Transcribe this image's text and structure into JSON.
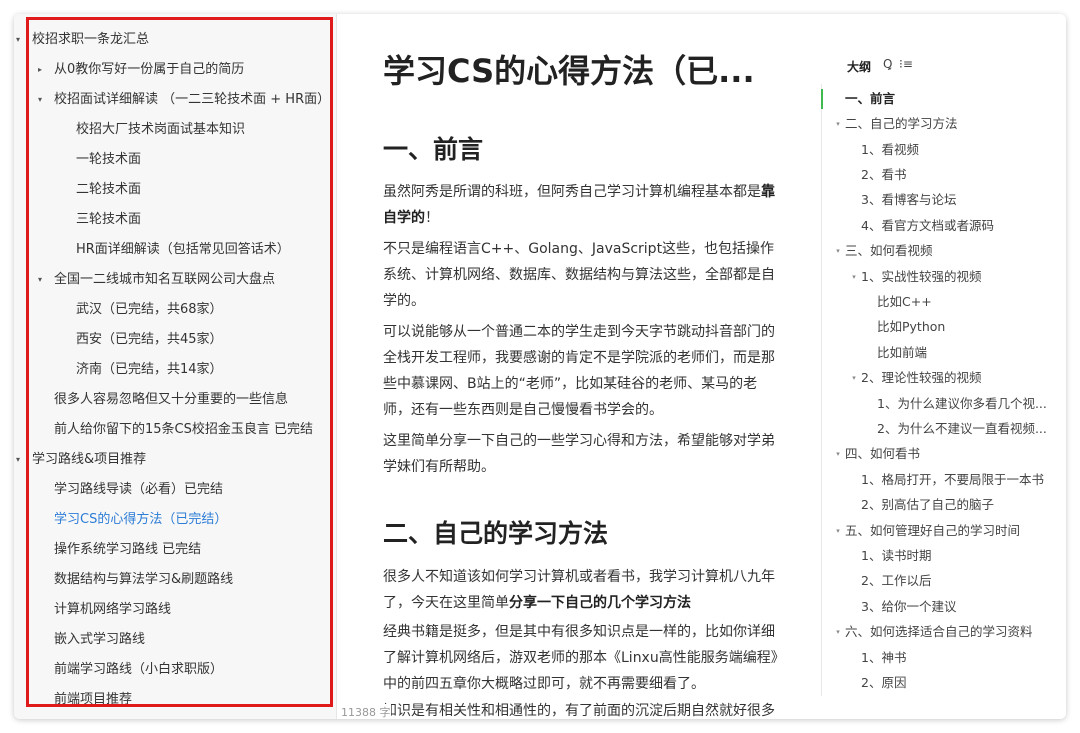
{
  "sidebar": {
    "items": [
      {
        "label": "校招求职一条龙汇总",
        "caret": "▾"
      },
      {
        "label": "从0教你写好一份属于自己的简历",
        "caret": "▸"
      },
      {
        "label": "校招面试详细解读 （一二三轮技术面 + HR面）",
        "caret": "▾"
      },
      {
        "label": "校招大厂技术岗面试基本知识",
        "caret": ""
      },
      {
        "label": "一轮技术面",
        "caret": ""
      },
      {
        "label": "二轮技术面",
        "caret": ""
      },
      {
        "label": "三轮技术面",
        "caret": ""
      },
      {
        "label": "HR面详细解读（包括常见回答话术）",
        "caret": ""
      },
      {
        "label": "全国一二线城市知名互联网公司大盘点",
        "caret": "▾"
      },
      {
        "label": "武汉（已完结，共68家）",
        "caret": ""
      },
      {
        "label": "西安（已完结，共45家）",
        "caret": ""
      },
      {
        "label": "济南（已完结，共14家）",
        "caret": ""
      },
      {
        "label": "很多人容易忽略但又十分重要的一些信息",
        "caret": ""
      },
      {
        "label": "前人给你留下的15条CS校招金玉良言 已完结",
        "caret": ""
      },
      {
        "label": "学习路线&项目推荐",
        "caret": "▾"
      },
      {
        "label": "学习路线导读（必看）已完结",
        "caret": ""
      },
      {
        "label": "学习CS的心得方法（已完结）",
        "caret": ""
      },
      {
        "label": "操作系统学习路线 已完结",
        "caret": ""
      },
      {
        "label": "数据结构与算法学习&刷题路线",
        "caret": ""
      },
      {
        "label": "计算机网络学习路线",
        "caret": ""
      },
      {
        "label": "嵌入式学习路线",
        "caret": ""
      },
      {
        "label": "前端学习路线（小白求职版）",
        "caret": ""
      },
      {
        "label": "前端项目推荐",
        "caret": ""
      }
    ]
  },
  "doc": {
    "title": "学习CS的心得方法（已...",
    "h1_intro": "一、前言",
    "p1a": "虽然阿秀是所谓的科班，但阿秀自己学习计算机编程基本都是",
    "p1b": "靠自学的",
    "p1c": "！",
    "p2": "不只是编程语言C++、Golang、JavaScript这些，也包括操作系统、计算机网络、数据库、数据结构与算法这些，全部都是自学的。",
    "p3": "可以说能够从一个普通二本的学生走到今天字节跳动抖音部门的全栈开发工程师，我要感谢的肯定不是学院派的老师们，而是那些中慕课网、B站上的“老师”，比如某硅谷的老师、某马的老师，还有一些东西则是自己慢慢看书学会的。",
    "p4": "这里简单分享一下自己的一些学习心得和方法，希望能够对学弟学妹们有所帮助。",
    "h1_method": "二、自己的学习方法",
    "p5a": "很多人不知道该如何学习计算机或者看书，我学习计算机八九年了，今天在这里简单",
    "p5b": "分享一下自己的几个学习方法",
    "p6": "经典书籍是挺多，但是其中有很多知识点是一样的，比如你详细了解计算机网络后，游双老师的那本《Linxu高性能服务端编程》中的前四五章你大概略过即可，就不再需要细看了。",
    "p7": "知识是有相关性和相通性的，有了前面的沉淀后期自然就好很多",
    "word_count": "11388 字"
  },
  "outline": {
    "header": "大纲",
    "pin_icon": "Ꝗ",
    "list_icon": "⁝≡",
    "items": [
      {
        "label": "一、前言",
        "caret": ""
      },
      {
        "label": "二、自己的学习方法",
        "caret": "▾"
      },
      {
        "label": "1、看视频",
        "caret": ""
      },
      {
        "label": "2、看书",
        "caret": ""
      },
      {
        "label": "3、看博客与论坛",
        "caret": ""
      },
      {
        "label": "4、看官方文档或者源码",
        "caret": ""
      },
      {
        "label": "三、如何看视频",
        "caret": "▾"
      },
      {
        "label": "1、实战性较强的视频",
        "caret": "▾"
      },
      {
        "label": "比如C++",
        "caret": ""
      },
      {
        "label": "比如Python",
        "caret": ""
      },
      {
        "label": "比如前端",
        "caret": ""
      },
      {
        "label": "2、理论性较强的视频",
        "caret": "▾"
      },
      {
        "label": "1、为什么建议你多看几个视...",
        "caret": ""
      },
      {
        "label": "2、为什么不建议一直看视频...",
        "caret": ""
      },
      {
        "label": "四、如何看书",
        "caret": "▾"
      },
      {
        "label": "1、格局打开，不要局限于一本书",
        "caret": ""
      },
      {
        "label": "2、别高估了自己的脑子",
        "caret": ""
      },
      {
        "label": "五、如何管理好自己的学习时间",
        "caret": "▾"
      },
      {
        "label": "1、读书时期",
        "caret": ""
      },
      {
        "label": "2、工作以后",
        "caret": ""
      },
      {
        "label": "3、给你一个建议",
        "caret": ""
      },
      {
        "label": "六、如何选择适合自己的学习资料",
        "caret": "▾"
      },
      {
        "label": "1、神书",
        "caret": ""
      },
      {
        "label": "2、原因",
        "caret": ""
      }
    ]
  }
}
